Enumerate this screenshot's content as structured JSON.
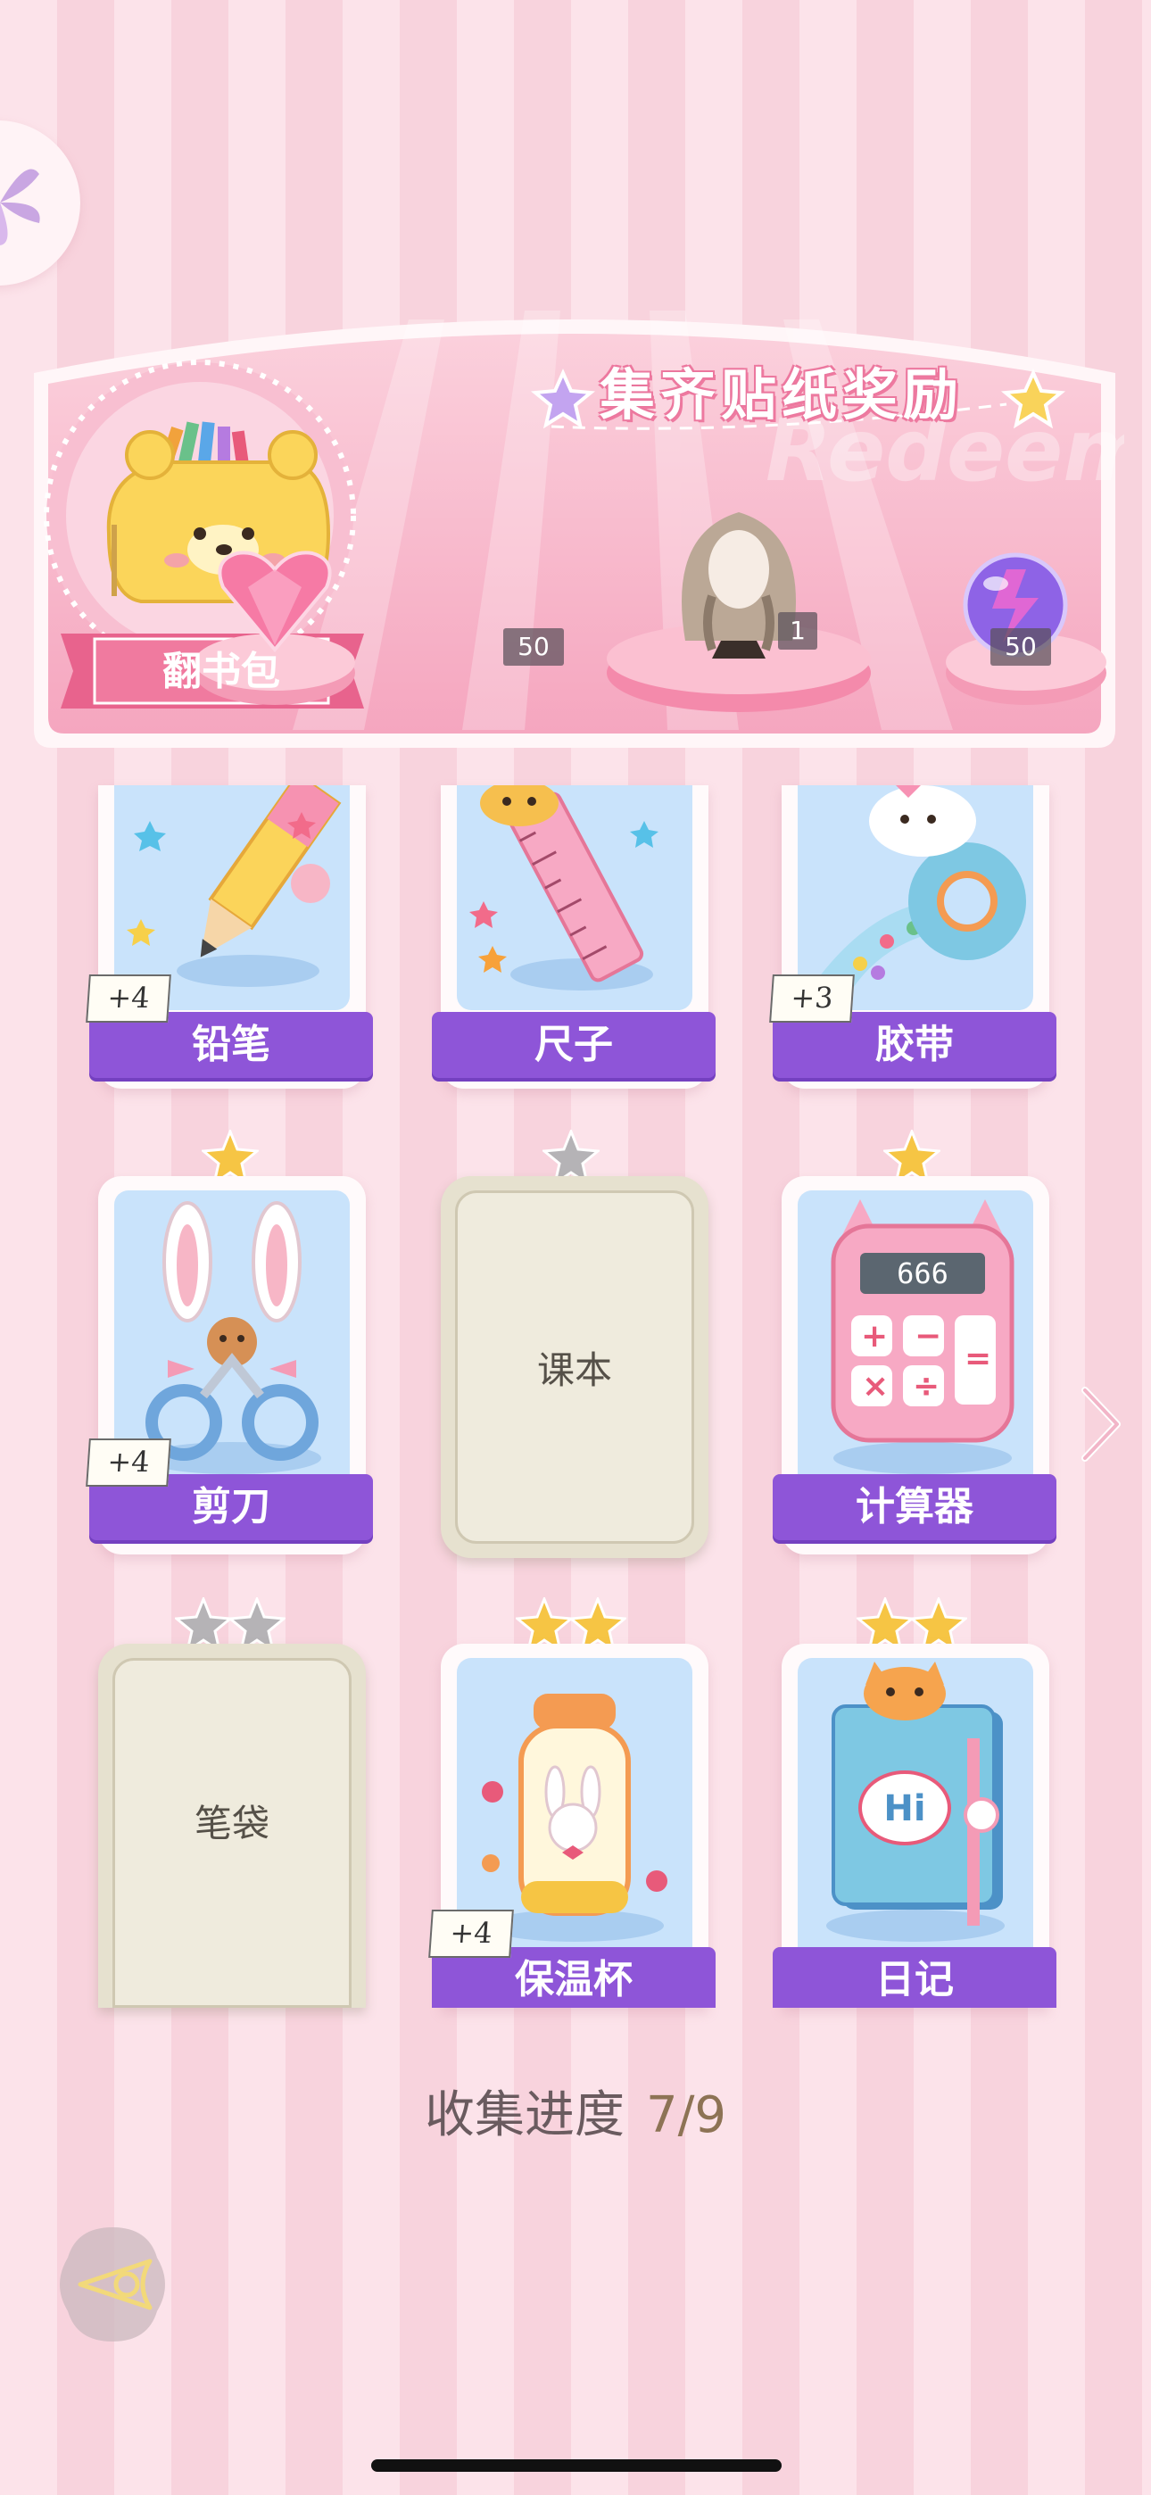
{
  "banner": {
    "title": "集齐贴纸奖励",
    "watermark": "Redeem",
    "bag_label": "翻书包",
    "rewards": [
      {
        "icon": "pink-heart-gem-icon",
        "count": "50"
      },
      {
        "icon": "character-avatar-icon",
        "count": "1"
      },
      {
        "icon": "purple-energy-orb-icon",
        "count": "50"
      }
    ]
  },
  "cards": [
    {
      "name": "铅笔",
      "plus": "+4",
      "stars": 0,
      "state": "owned"
    },
    {
      "name": "尺子",
      "plus": "",
      "stars": 0,
      "state": "owned"
    },
    {
      "name": "胶带",
      "plus": "+3",
      "stars": 0,
      "state": "owned"
    },
    {
      "name": "剪刀",
      "plus": "+4",
      "stars": 1,
      "state": "owned"
    },
    {
      "name": "课本",
      "plus": "",
      "stars": 1,
      "state": "locked"
    },
    {
      "name": "计算器",
      "plus": "",
      "stars": 1,
      "state": "owned"
    },
    {
      "name": "笔袋",
      "plus": "",
      "stars": 2,
      "state": "locked"
    },
    {
      "name": "保温杯",
      "plus": "+4",
      "stars": 2,
      "state": "owned"
    },
    {
      "name": "日记",
      "plus": "",
      "stars": 2,
      "state": "owned"
    }
  ],
  "calculator_display": "666",
  "diary_text": "Hi",
  "progress": {
    "label": "收集进度",
    "value": "7/9"
  },
  "colors": {
    "tag_purple": "#8e55d8",
    "banner_pink": "#f6a8c0",
    "card_blue": "#c9e3fb",
    "star_gold": "#f6c544"
  }
}
